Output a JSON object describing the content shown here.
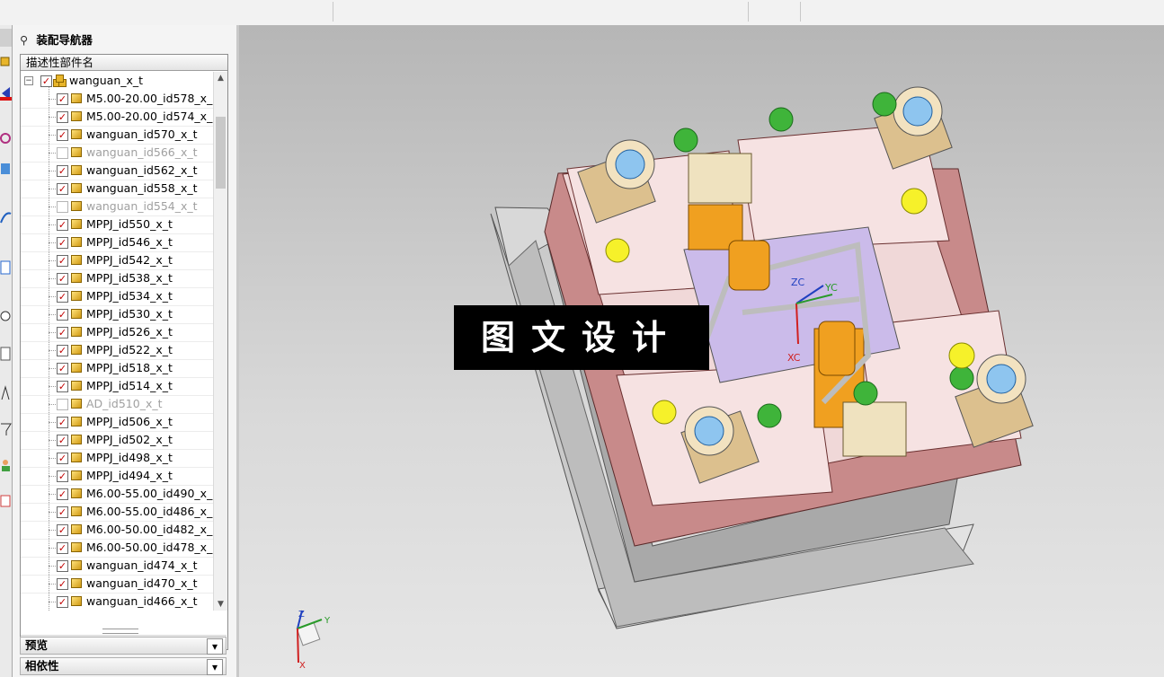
{
  "navigator": {
    "title": "装配导航器",
    "column_header": "描述性部件名",
    "root": {
      "label": "wanguan_x_t",
      "checked": true
    },
    "items": [
      {
        "label": "M5.00-20.00_id578_x_",
        "checked": true
      },
      {
        "label": "M5.00-20.00_id574_x_",
        "checked": true
      },
      {
        "label": "wanguan_id570_x_t",
        "checked": true
      },
      {
        "label": "wanguan_id566_x_t",
        "checked": false
      },
      {
        "label": "wanguan_id562_x_t",
        "checked": true
      },
      {
        "label": "wanguan_id558_x_t",
        "checked": true
      },
      {
        "label": "wanguan_id554_x_t",
        "checked": false
      },
      {
        "label": "MPPJ_id550_x_t",
        "checked": true
      },
      {
        "label": "MPPJ_id546_x_t",
        "checked": true
      },
      {
        "label": "MPPJ_id542_x_t",
        "checked": true
      },
      {
        "label": "MPPJ_id538_x_t",
        "checked": true
      },
      {
        "label": "MPPJ_id534_x_t",
        "checked": true
      },
      {
        "label": "MPPJ_id530_x_t",
        "checked": true
      },
      {
        "label": "MPPJ_id526_x_t",
        "checked": true
      },
      {
        "label": "MPPJ_id522_x_t",
        "checked": true
      },
      {
        "label": "MPPJ_id518_x_t",
        "checked": true
      },
      {
        "label": "MPPJ_id514_x_t",
        "checked": true
      },
      {
        "label": "AD_id510_x_t",
        "checked": false
      },
      {
        "label": "MPPJ_id506_x_t",
        "checked": true
      },
      {
        "label": "MPPJ_id502_x_t",
        "checked": true
      },
      {
        "label": "MPPJ_id498_x_t",
        "checked": true
      },
      {
        "label": "MPPJ_id494_x_t",
        "checked": true
      },
      {
        "label": "M6.00-55.00_id490_x_",
        "checked": true
      },
      {
        "label": "M6.00-55.00_id486_x_",
        "checked": true
      },
      {
        "label": "M6.00-50.00_id482_x_",
        "checked": true
      },
      {
        "label": "M6.00-50.00_id478_x_",
        "checked": true
      },
      {
        "label": "wanguan_id474_x_t",
        "checked": true
      },
      {
        "label": "wanguan_id470_x_t",
        "checked": true
      },
      {
        "label": "wanguan_id466_x_t",
        "checked": true
      }
    ],
    "sections": [
      {
        "label": "预览"
      },
      {
        "label": "相依性"
      }
    ]
  },
  "viewport": {
    "watermark": "图文设计",
    "wcs_labels": {
      "zc": "ZC",
      "yc": "YC",
      "xc": "XC"
    },
    "triad_labels": {
      "z": "Z",
      "y": "Y",
      "x": "X"
    }
  },
  "colors": {
    "plate": "#f2dada",
    "plate_side": "#b06a6a",
    "bushing": "#8ec5ef",
    "sleeve": "#e8cfa2",
    "bolt": "#3fb43a",
    "slider": "#f0a020",
    "guide_plate": "#c9b8e8",
    "yellow_dot": "#f6f12a"
  }
}
